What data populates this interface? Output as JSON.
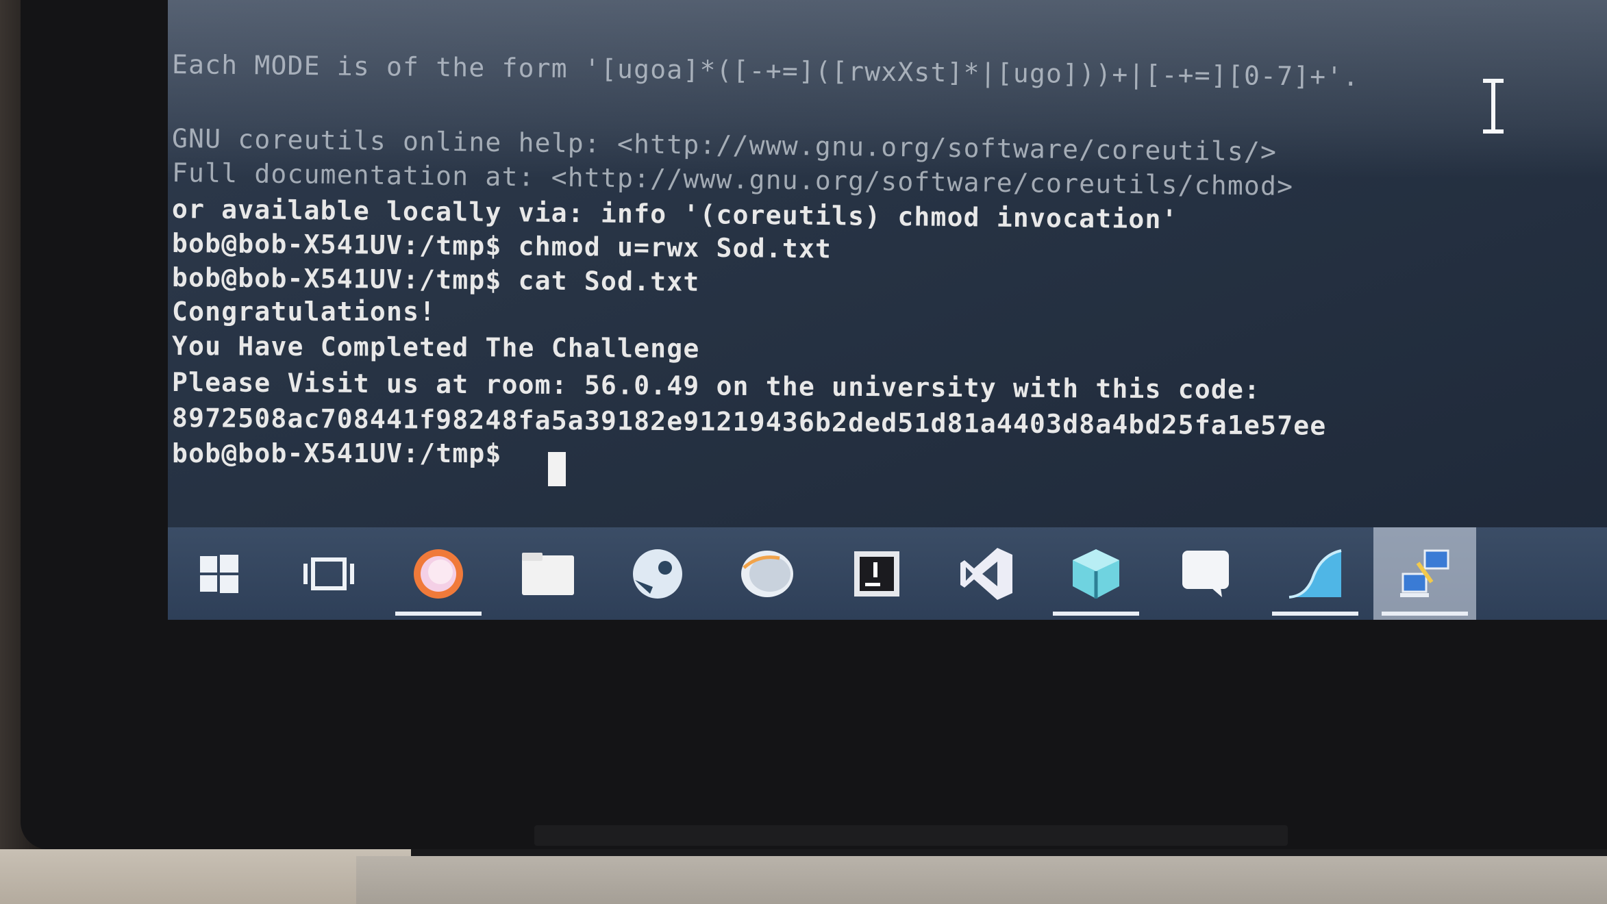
{
  "terminal": {
    "lines": [
      "Each MODE is of the form '[ugoa]*([-+=]([rwxXst]*|[ugo]))+|[-+=][0-7]+'.",
      "GNU coreutils online help: <http://www.gnu.org/software/coreutils/>",
      "Full documentation at: <http://www.gnu.org/software/coreutils/chmod>",
      "or available locally via: info '(coreutils) chmod invocation'",
      "bob@bob-X541UV:/tmp$ chmod u=rwx Sod.txt",
      "bob@bob-X541UV:/tmp$ cat Sod.txt",
      "Congratulations!",
      "You Have Completed The Challenge",
      "Please Visit us at room: 56.0.49 on the university with this code:",
      "8972508ac708441f98248fa5a39182e91219436b2ded51d81a4403d8a4bd25fa1e57ee",
      "bob@bob-X541UV:/tmp$ "
    ]
  },
  "taskbar": {
    "items": [
      {
        "icon": "windows-start-icon",
        "active": false,
        "open": false
      },
      {
        "icon": "task-view-icon",
        "active": false,
        "open": false
      },
      {
        "icon": "firefox-icon",
        "active": false,
        "open": true
      },
      {
        "icon": "file-explorer-icon",
        "active": false,
        "open": false
      },
      {
        "icon": "steam-icon",
        "active": false,
        "open": false
      },
      {
        "icon": "browser-icon",
        "active": false,
        "open": false
      },
      {
        "icon": "intellij-icon",
        "active": false,
        "open": false
      },
      {
        "icon": "visual-studio-icon",
        "active": false,
        "open": false
      },
      {
        "icon": "virtualbox-icon",
        "active": false,
        "open": true
      },
      {
        "icon": "chat-icon",
        "active": false,
        "open": false
      },
      {
        "icon": "wireshark-icon",
        "active": false,
        "open": true
      },
      {
        "icon": "remote-desktop-icon",
        "active": true,
        "open": true
      }
    ]
  },
  "colors": {
    "terminal_bg": "#263243",
    "terminal_text": "#e8e8e8",
    "taskbar_bg": "#34465f",
    "cursor": "#f2f2f2"
  }
}
